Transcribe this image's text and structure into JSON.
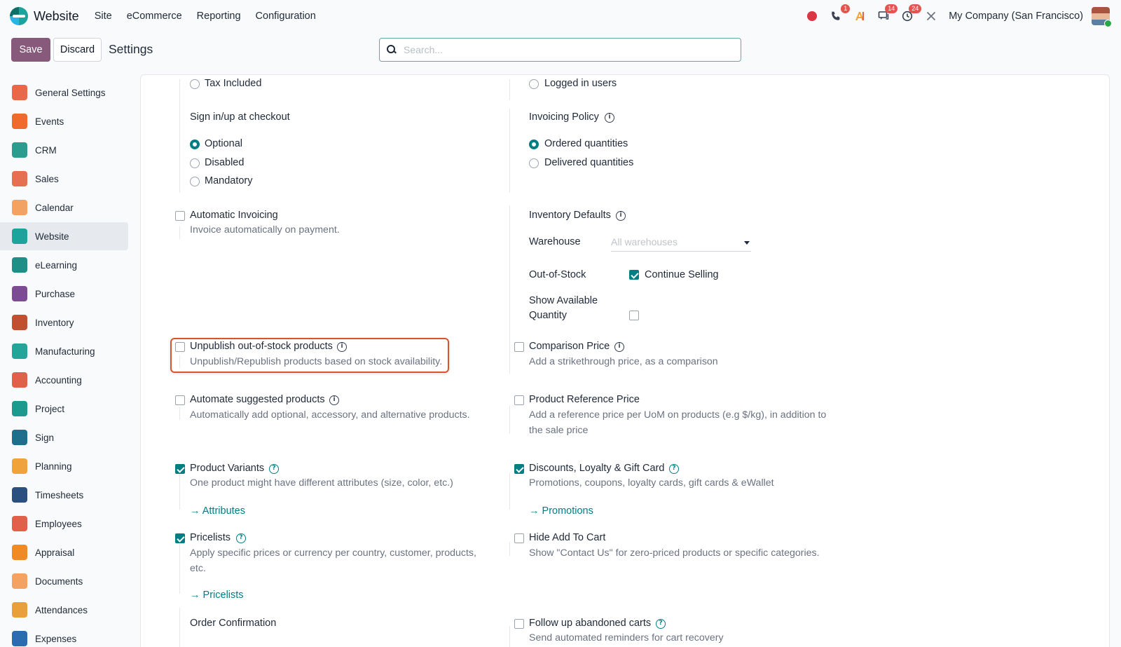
{
  "brand": {
    "name": "Website"
  },
  "menu": [
    "Site",
    "eCommerce",
    "Reporting",
    "Configuration"
  ],
  "systray": {
    "phone_badge": "1",
    "chat_badge": "14",
    "activity_badge": "24",
    "company": "My Company (San Francisco)"
  },
  "control": {
    "save_label": "Save",
    "discard_label": "Discard",
    "title": "Settings",
    "search_placeholder": "Search..."
  },
  "sidebar": {
    "items": [
      {
        "label": "General Settings",
        "icon": "general-settings-icon",
        "color": "#e9684a"
      },
      {
        "label": "Events",
        "icon": "events-icon",
        "color": "#f06a2b"
      },
      {
        "label": "CRM",
        "icon": "crm-icon",
        "color": "#2a9d8f"
      },
      {
        "label": "Sales",
        "icon": "sales-icon",
        "color": "#e76f51"
      },
      {
        "label": "Calendar",
        "icon": "calendar-icon",
        "color": "#f4a261"
      },
      {
        "label": "Website",
        "icon": "website-icon",
        "color": "#1ba39c"
      },
      {
        "label": "eLearning",
        "icon": "elearning-icon",
        "color": "#1d8f87"
      },
      {
        "label": "Purchase",
        "icon": "purchase-icon",
        "color": "#7b4b94"
      },
      {
        "label": "Inventory",
        "icon": "inventory-icon",
        "color": "#c0502f"
      },
      {
        "label": "Manufacturing",
        "icon": "manufacturing-icon",
        "color": "#23a699"
      },
      {
        "label": "Accounting",
        "icon": "accounting-icon",
        "color": "#e0604a"
      },
      {
        "label": "Project",
        "icon": "project-icon",
        "color": "#1d9a8e"
      },
      {
        "label": "Sign",
        "icon": "sign-icon",
        "color": "#1e6f8c"
      },
      {
        "label": "Planning",
        "icon": "planning-icon",
        "color": "#f0a23b"
      },
      {
        "label": "Timesheets",
        "icon": "timesheets-icon",
        "color": "#2b4f7e"
      },
      {
        "label": "Employees",
        "icon": "employees-icon",
        "color": "#e0604a"
      },
      {
        "label": "Appraisal",
        "icon": "appraisal-icon",
        "color": "#f08a24"
      },
      {
        "label": "Documents",
        "icon": "documents-icon",
        "color": "#f4a261"
      },
      {
        "label": "Attendances",
        "icon": "attendances-icon",
        "color": "#e9a03b"
      },
      {
        "label": "Expenses",
        "icon": "expenses-icon",
        "color": "#2b6cb0"
      }
    ],
    "active_index": 5
  },
  "settings": {
    "tax_included": "Tax Included",
    "logged_in_users": "Logged in users",
    "signin_title": "Sign in/up at checkout",
    "signin_options": [
      "Optional",
      "Disabled",
      "Mandatory"
    ],
    "invoicing_policy_title": "Invoicing Policy",
    "invoicing_options": [
      "Ordered quantities",
      "Delivered quantities"
    ],
    "auto_invoicing": {
      "label": "Automatic Invoicing",
      "desc": "Invoice automatically on payment."
    },
    "inventory_defaults": {
      "title": "Inventory Defaults",
      "warehouse_label": "Warehouse",
      "warehouse_placeholder": "All warehouses",
      "oos_label": "Out-of-Stock",
      "continue_selling": "Continue Selling",
      "show_qty_line1": "Show Available",
      "show_qty_line2": "Quantity"
    },
    "unpublish": {
      "label": "Unpublish out-of-stock products",
      "desc": "Unpublish/Republish products based on stock availability."
    },
    "comparison_price": {
      "label": "Comparison Price",
      "desc": "Add a strikethrough price, as a comparison"
    },
    "automate_suggested": {
      "label": "Automate suggested products",
      "desc": "Automatically add optional, accessory, and alternative products."
    },
    "reference_price": {
      "label": "Product Reference Price",
      "desc1": "Add a reference price per UoM on products (e.g $/kg), in addition to",
      "desc2": "the sale price"
    },
    "variants": {
      "label": "Product Variants",
      "desc": "One product might have different attributes (size, color, etc.)",
      "link": "Attributes"
    },
    "discounts": {
      "label": "Discounts, Loyalty & Gift Card",
      "desc": "Promotions, coupons, loyalty cards, gift cards & eWallet",
      "link": "Promotions"
    },
    "pricelists": {
      "label": "Pricelists",
      "desc1": "Apply specific prices or currency per country, customer, products,",
      "desc2": "etc.",
      "link": "Pricelists"
    },
    "hide_add_to_cart": {
      "label": "Hide Add To Cart",
      "desc": "Show \"Contact Us\" for zero-priced products or specific categories."
    },
    "order_confirmation": "Order Confirmation",
    "abandoned_carts": {
      "label": "Follow up abandoned carts",
      "desc": "Send automated reminders for cart recovery"
    }
  }
}
